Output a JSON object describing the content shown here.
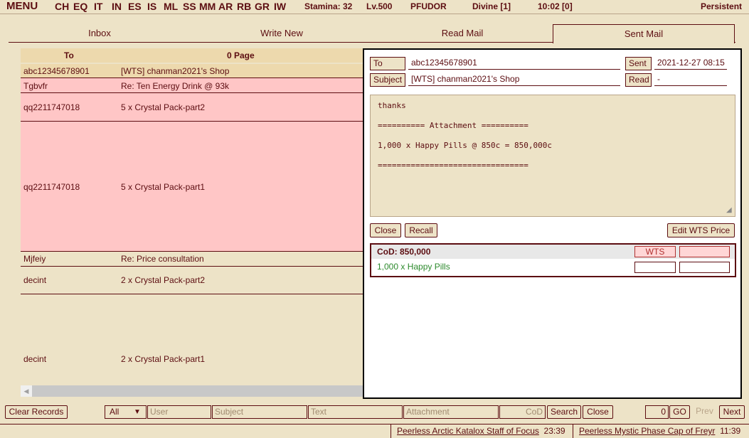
{
  "nav": {
    "menu": "MENU",
    "links": [
      "CH",
      "EQ",
      "IT",
      "IN",
      "ES",
      "IS",
      "ML",
      "SS",
      "MM",
      "AR",
      "RB",
      "GR",
      "IW"
    ],
    "stamina": "Stamina: 32",
    "level": "Lv.500",
    "name": "PFUDOR",
    "difficulty": "Divine [1]",
    "time": "10:02 [0]",
    "persistent": "Persistent"
  },
  "tabs": [
    "Inbox",
    "Write New",
    "Read Mail",
    "Sent Mail"
  ],
  "active_tab": "Sent Mail",
  "list": {
    "col_to": "To",
    "col_page": "0 Page",
    "rows": [
      {
        "to": "abc12345678901",
        "subject": "[WTS] chanman2021's Shop"
      },
      {
        "to": "Tgbvfr",
        "subject": "Re: Ten Energy Drink @ 93k"
      },
      {
        "to": "qq2211747018",
        "subject": "5 x Crystal Pack-part2"
      },
      {
        "to": "qq2211747018",
        "subject": "5 x Crystal Pack-part1"
      },
      {
        "to": "Mjfeiy",
        "subject": "Re: Price consultation"
      },
      {
        "to": "decint",
        "subject": "2 x Crystal Pack-part2"
      },
      {
        "to": "decint",
        "subject": "2 x Crystal Pack-part1"
      }
    ]
  },
  "detail": {
    "to_label": "To",
    "to_value": "abc12345678901",
    "subject_label": "Subject",
    "subject_value": "[WTS] chanman2021's Shop",
    "sent_label": "Sent",
    "sent_value": "2021-12-27 08:15",
    "read_label": "Read",
    "read_value": "-",
    "body": "thanks\n\n========== Attachment ==========\n\n1,000 x Happy Pills @ 850c = 850,000c\n\n================================",
    "close_btn": "Close",
    "recall_btn": "Recall",
    "edit_wts_btn": "Edit WTS Price",
    "cod": "CoD: 850,000",
    "wts": "WTS",
    "attachment_item": "1,000 x Happy Pills"
  },
  "searchbar": {
    "clear_records": "Clear Records",
    "filter": "All",
    "user_placeholder": "User",
    "subject_placeholder": "Subject",
    "text_placeholder": "Text",
    "attachment_placeholder": "Attachment",
    "cod_placeholder": "CoD",
    "search_btn": "Search",
    "close_btn": "Close",
    "page_value": "0",
    "go_btn": "GO",
    "prev_btn": "Prev",
    "next_btn": "Next"
  },
  "footer": [
    {
      "name": "Peerless Arctic Katalox Staff of Focus",
      "time": "23:39"
    },
    {
      "name": "Peerless Mystic Phase Cap of Freyr",
      "time": "11:39"
    }
  ]
}
